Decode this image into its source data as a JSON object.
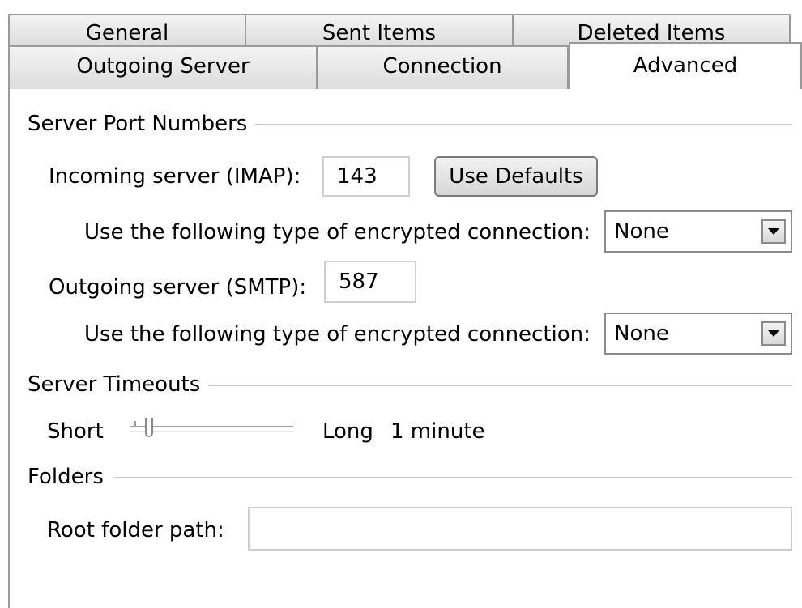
{
  "tabs": {
    "row1": [
      "General",
      "Sent Items",
      "Deleted Items"
    ],
    "row2": [
      "Outgoing Server",
      "Connection",
      "Advanced"
    ],
    "selected": "Advanced"
  },
  "ports": {
    "section_title": "Server Port Numbers",
    "incoming_label": "Incoming server (IMAP):",
    "incoming_value": "143",
    "use_defaults_label": "Use Defaults",
    "encryption_label": "Use the following type of encrypted connection:",
    "incoming_encryption": "None",
    "outgoing_label": "Outgoing server (SMTP):",
    "outgoing_value": "587",
    "outgoing_encryption": "None"
  },
  "timeouts": {
    "section_title": "Server Timeouts",
    "short_label": "Short",
    "long_label": "Long",
    "value_text": "1 minute",
    "slider_position": 0.1
  },
  "folders": {
    "section_title": "Folders",
    "root_folder_label": "Root folder path:",
    "root_folder_value": ""
  }
}
